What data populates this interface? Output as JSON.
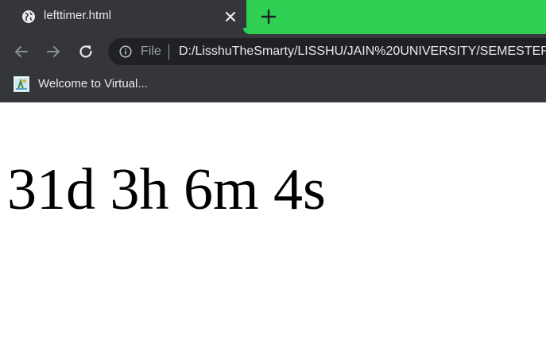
{
  "tab": {
    "title": "lefttimer.html",
    "favicon": "globe-icon",
    "close_icon": "close-icon"
  },
  "new_tab_icon": "plus-icon",
  "toolbar": {
    "back_icon": "arrow-left-icon",
    "forward_icon": "arrow-right-icon",
    "reload_icon": "reload-icon",
    "site_info_icon": "info-icon",
    "scheme": "File",
    "url": "D:/LisshuTheSmarty/LISSHU/JAIN%20UNIVERSITY/SEMESTER"
  },
  "bookmarks": [
    {
      "label": "Welcome to Virtual..."
    }
  ],
  "page": {
    "timer_text": "31d 3h 6m 4s"
  },
  "colors": {
    "frame": "#2ecf52",
    "tab_active": "#35363a",
    "omnibox": "#202124",
    "text_light": "#e8eaed",
    "text_muted": "#9aa0a6"
  }
}
